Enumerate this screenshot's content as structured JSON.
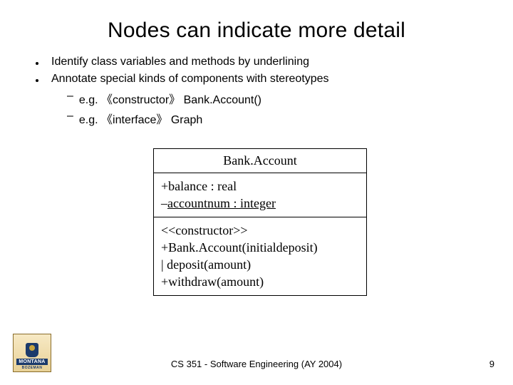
{
  "title": "Nodes can indicate more detail",
  "bullets": [
    "Identify class variables and methods by underlining",
    "Annotate special kinds of components with stereotypes"
  ],
  "sub_bullets": [
    "e.g. 《constructor》 Bank.Account()",
    "e.g. 《interface》 Graph"
  ],
  "diagram": {
    "class_name": "Bank.Account",
    "attr1": "+balance : real",
    "attr2_prefix": "–",
    "attr2_underlined": "accountnum : integer",
    "op_stereotype": "<<constructor>>",
    "op1": "+Bank.Account(initialdeposit)",
    "op2_prefix": "|",
    "op2_rest": " deposit(amount)",
    "op3": "+withdraw(amount)"
  },
  "logo": {
    "name": "MONTANA",
    "sub": "BOZEMAN"
  },
  "footer": {
    "center": "CS 351 - Software Engineering (AY 2004)",
    "page": "9"
  }
}
